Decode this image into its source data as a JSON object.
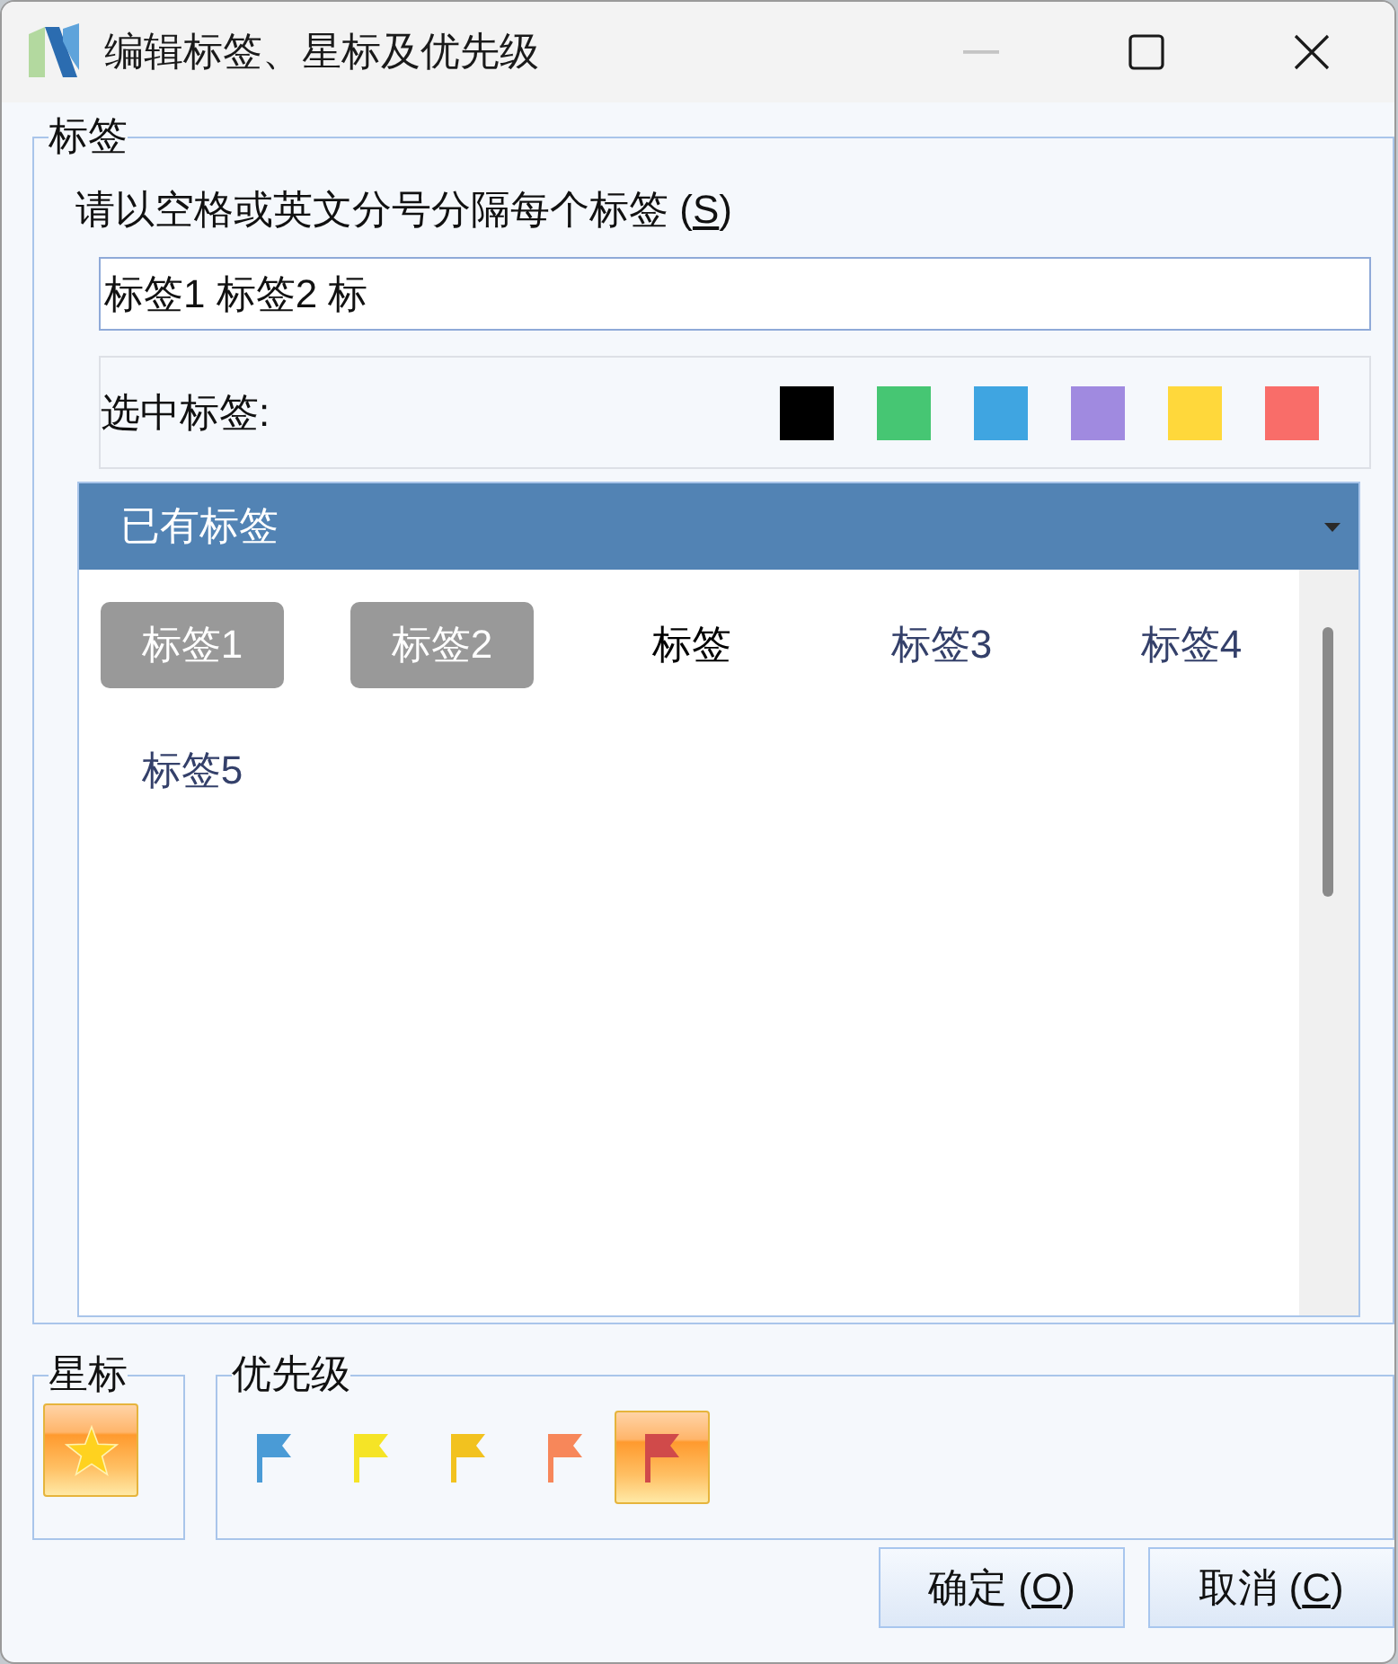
{
  "window": {
    "title": "编辑标签、星标及优先级",
    "controls": [
      {
        "kind": "minimize",
        "disabled": true
      },
      {
        "kind": "maximize",
        "disabled": false
      },
      {
        "kind": "close",
        "disabled": false
      }
    ]
  },
  "tags_group": {
    "title": "标签",
    "instruction": {
      "text": "请以空格或英文分号分隔每个标签 (",
      "access_key": "S",
      "text_after": ")"
    },
    "input": {
      "value": "标签1 标签2 标"
    },
    "selected_tags": {
      "label": "选中标签:",
      "colors": [
        {
          "color": "#000000"
        },
        {
          "color": "#46c673"
        },
        {
          "color": "#3fa5e1"
        },
        {
          "color": "#a08ae0"
        },
        {
          "color": "#ffd83b"
        },
        {
          "color": "#f96d69"
        }
      ]
    },
    "existing_tags": {
      "title": "已有标签",
      "tags": [
        {
          "label": "标签1",
          "selected": true,
          "highlighted": false
        },
        {
          "label": "标签2",
          "selected": true,
          "highlighted": false
        },
        {
          "label": "标签",
          "selected": false,
          "highlighted": true
        },
        {
          "label": "标签3",
          "selected": false,
          "highlighted": false
        },
        {
          "label": "标签4",
          "selected": false,
          "highlighted": false
        },
        {
          "label": "标签5",
          "selected": false,
          "highlighted": false
        }
      ]
    }
  },
  "star_group": {
    "title": "星标",
    "starred": true
  },
  "priority_group": {
    "title": "优先级",
    "flags": [
      {
        "color": "#4a9bd6",
        "selected": false
      },
      {
        "color": "#f5e426",
        "selected": false
      },
      {
        "color": "#f2c21f",
        "selected": false
      },
      {
        "color": "#f7875a",
        "selected": false
      },
      {
        "color": "#d04a4a",
        "selected": true
      }
    ]
  },
  "buttons": [
    {
      "text": "确定 (",
      "access_key": "O",
      "text_after": ")"
    },
    {
      "text": "取消 (",
      "access_key": "C",
      "text_after": ")"
    }
  ]
}
